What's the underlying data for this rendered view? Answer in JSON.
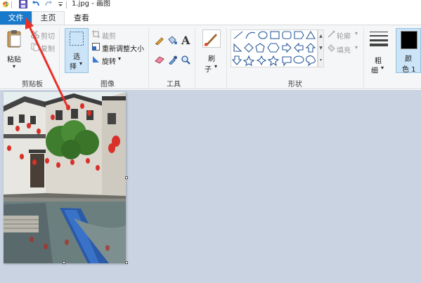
{
  "window": {
    "title": "1.jpg - 画图"
  },
  "tabs": {
    "file": "文件",
    "home": "主页",
    "view": "查看"
  },
  "clipboard": {
    "paste": "粘贴",
    "cut": "剪切",
    "copy": "复制",
    "group": "剪贴板"
  },
  "image": {
    "select_line1": "选",
    "select_line2": "择",
    "crop": "裁剪",
    "resize": "重新调整大小",
    "rotate": "旋转",
    "group": "图像"
  },
  "tools": {
    "group": "工具"
  },
  "brushes": {
    "line1": "刷",
    "line2": "子"
  },
  "shapes": {
    "outline": "轮廓",
    "fill": "填充",
    "group": "形状"
  },
  "size": {
    "line1": "粗",
    "line2": "细"
  },
  "color": {
    "line1": "颜",
    "line2": "色 1"
  },
  "colors": {
    "accent": "#1979ca",
    "annotation": "#e8302a",
    "workspace": "#c9d3e2",
    "ribbon": "#f5f6f7"
  }
}
